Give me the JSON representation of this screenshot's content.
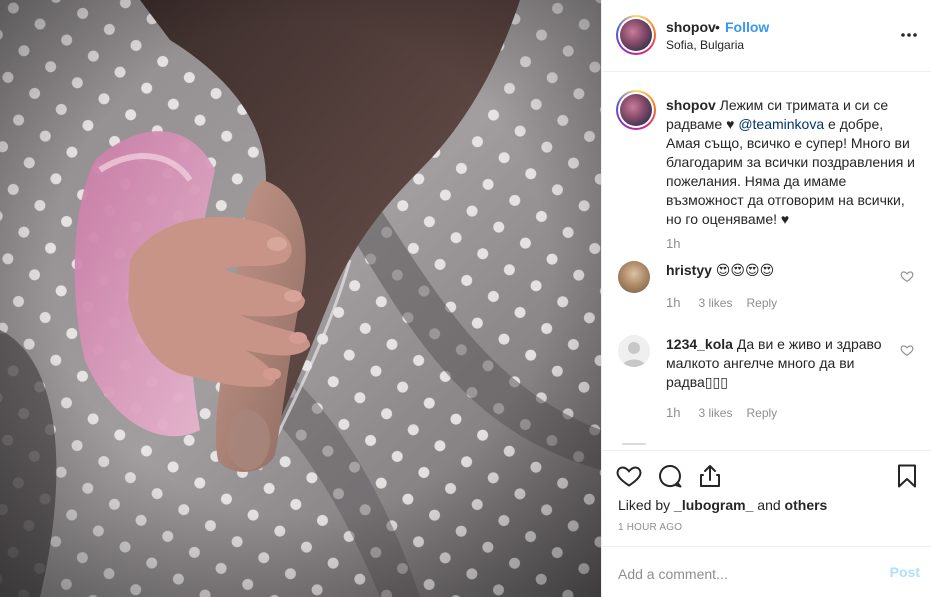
{
  "header": {
    "username": "shopov",
    "separator": "•",
    "follow_label": "Follow",
    "location": "Sofia, Bulgaria",
    "more_icon": "more-options-icon"
  },
  "caption": {
    "username": "shopov",
    "text_before_mention": " Лежим си тримата и си се радваме ♥ ",
    "mention": "@teaminkova",
    "text_after_mention": " е добре, Амая също, всичко е супер! Много ви благодарим за всички поздравления и пожелания. Няма да имаме възможност да отговорим на всички, но го оценяваме! ♥",
    "time": "1h"
  },
  "comments": [
    {
      "username": "hristyy",
      "text": " 😍😍😍😍",
      "time": "1h",
      "likes": "3 likes",
      "reply_label": "Reply"
    },
    {
      "username": "1234_kola",
      "text": " Да ви е живо и здраво малкото ангелче много да ви радва▯▯▯",
      "time": "1h",
      "likes": "3 likes",
      "reply_label": "Reply"
    }
  ],
  "actions": {
    "icons": [
      "heart-icon",
      "comment-bubble-icon",
      "share-icon",
      "bookmark-icon"
    ],
    "liked_by_prefix": "Liked by ",
    "liked_by_user": "_lubogram_",
    "liked_by_middle": " and ",
    "liked_by_others": "others",
    "post_time": "1 hour ago"
  },
  "add_comment": {
    "placeholder": "Add a comment...",
    "post_label": "Post"
  },
  "colors": {
    "link_blue": "#3897f0",
    "post_disabled": "#b2dffc",
    "muted_text": "#8e8e8e",
    "mention": "#003569",
    "divider": "#efefef"
  }
}
